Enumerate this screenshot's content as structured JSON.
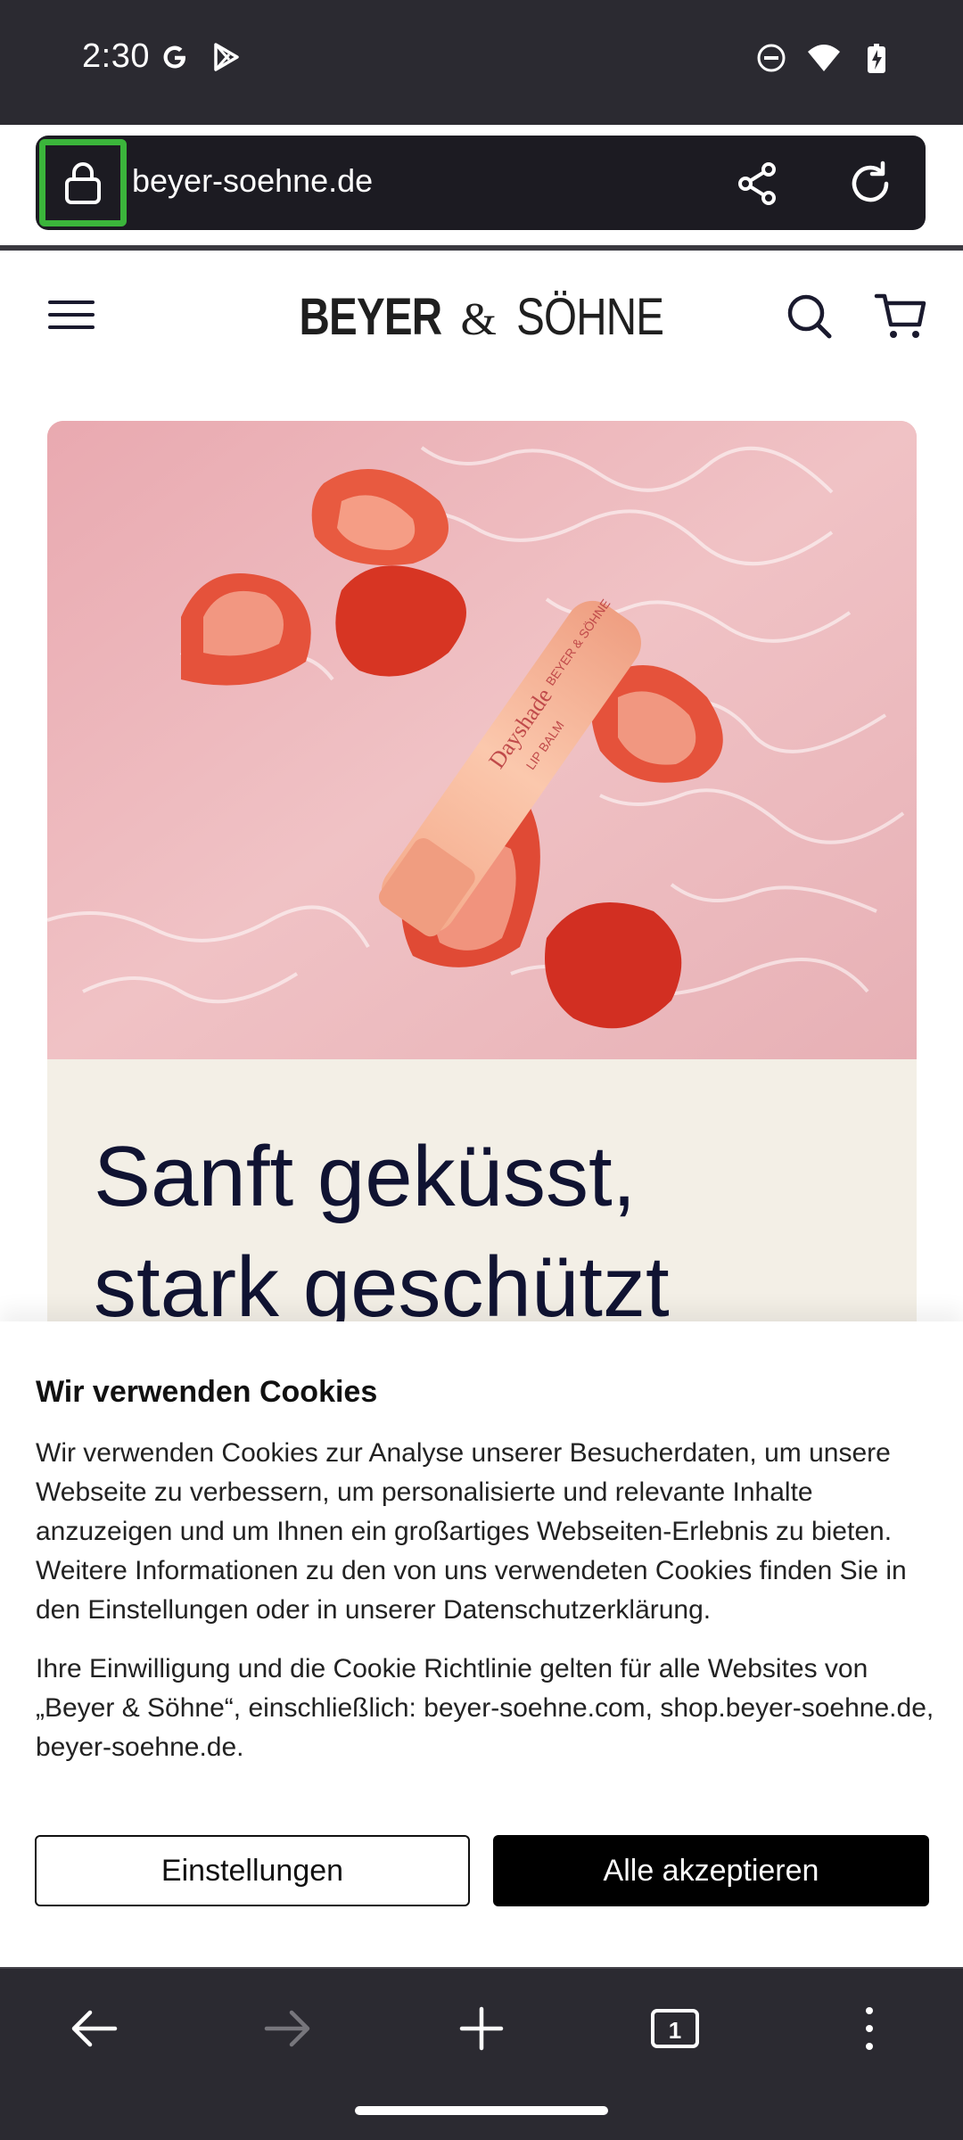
{
  "status_bar": {
    "time": "2:30",
    "left_icons": [
      "google-icon",
      "play-store-icon"
    ],
    "right_icons": [
      "do-not-disturb-icon",
      "wifi-icon",
      "battery-charging-icon"
    ]
  },
  "browser": {
    "url": "beyer-soehne.de",
    "lock_icon": "lock-icon",
    "share_icon": "share-icon",
    "reload_icon": "reload-icon",
    "tab_count": "1"
  },
  "site": {
    "logo_part1": "BEYER",
    "logo_amp": "&",
    "logo_part2": "SÖHNE",
    "hero_title_line1": "Sanft geküsst,",
    "hero_title_line2": "stark geschützt",
    "hero_product_text1": "BEYER & SÖHNE",
    "hero_product_text2": "Dayshade",
    "hero_product_text3": "LIP BALM"
  },
  "cookie_banner": {
    "title": "Wir verwenden Cookies",
    "body1": "Wir verwenden Cookies zur Analyse unserer Besucherdaten, um unsere Webseite zu verbessern, um personalisierte und relevante Inhalte anzuzeigen und um Ihnen ein großartiges Webseiten-Erlebnis zu bieten. Weitere Informationen zu den von uns verwendeten Cookies finden Sie in den Einstellungen oder in unserer Datenschutzerklärung.",
    "body2": "Ihre Einwilligung und die Cookie Richtlinie gelten für alle Websites von „Beyer & Söhne“, einschließlich: beyer-soehne.com, shop.beyer-soehne.de, beyer-soehne.de.",
    "settings_label": "Einstellungen",
    "accept_label": "Alle akzeptieren"
  },
  "colors": {
    "browser_chrome": "#2b2a31",
    "url_bar": "#1c1b22",
    "focus_highlight": "#3bb53b",
    "hero_panel": "#f3efe6",
    "hero_title": "#101332",
    "hero_image_bg": "#eab3b8"
  }
}
